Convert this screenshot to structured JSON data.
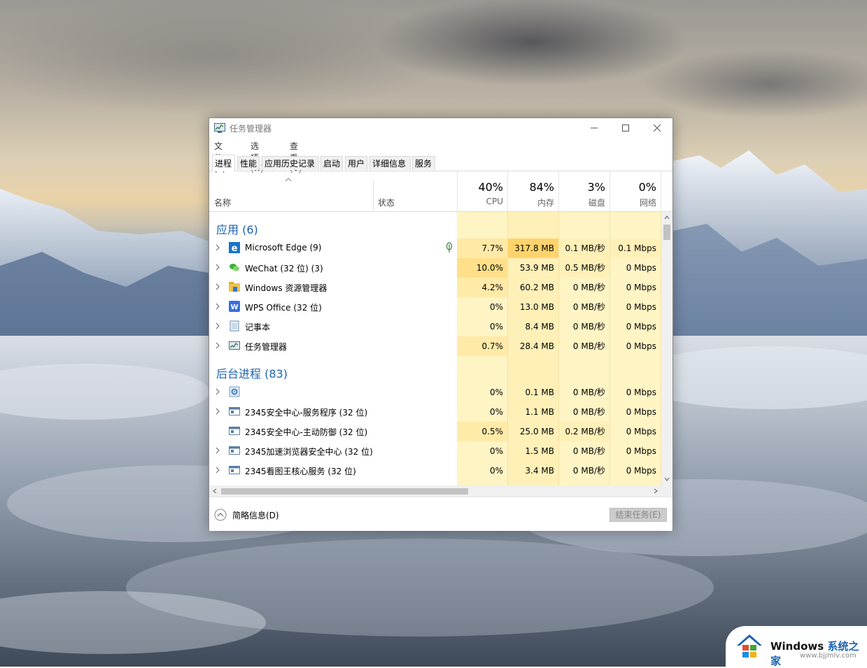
{
  "window": {
    "title": "任务管理器",
    "menu": [
      "文件(F)",
      "选项(O)",
      "查看(V)"
    ],
    "tabs": [
      "进程",
      "性能",
      "应用历史记录",
      "启动",
      "用户",
      "详细信息",
      "服务"
    ]
  },
  "columns": {
    "name": "名称",
    "status": "状态",
    "cpu": {
      "pct": "40%",
      "label": "CPU"
    },
    "memory": {
      "pct": "84%",
      "label": "内存"
    },
    "disk": {
      "pct": "3%",
      "label": "磁盘"
    },
    "network": {
      "pct": "0%",
      "label": "网络"
    }
  },
  "groups": {
    "apps": "应用 (6)",
    "background": "后台进程 (83)"
  },
  "apps": [
    {
      "name": "Microsoft Edge (9)",
      "cpu": "7.7%",
      "mem": "317.8 MB",
      "disk": "0.1 MB/秒",
      "net": "0.1 Mbps",
      "icon": "edge-icon"
    },
    {
      "name": "WeChat (32 位) (3)",
      "cpu": "10.0%",
      "mem": "53.9 MB",
      "disk": "0.5 MB/秒",
      "net": "0 Mbps",
      "icon": "wechat-icon"
    },
    {
      "name": "Windows 资源管理器",
      "cpu": "4.2%",
      "mem": "60.2 MB",
      "disk": "0 MB/秒",
      "net": "0 Mbps",
      "icon": "explorer-icon"
    },
    {
      "name": "WPS Office (32 位)",
      "cpu": "0%",
      "mem": "13.0 MB",
      "disk": "0 MB/秒",
      "net": "0 Mbps",
      "icon": "wps-icon"
    },
    {
      "name": "记事本",
      "cpu": "0%",
      "mem": "8.4 MB",
      "disk": "0 MB/秒",
      "net": "0 Mbps",
      "icon": "notepad-icon"
    },
    {
      "name": "任务管理器",
      "cpu": "0.7%",
      "mem": "28.4 MB",
      "disk": "0 MB/秒",
      "net": "0 Mbps",
      "icon": "taskmgr-icon"
    }
  ],
  "background": [
    {
      "name": "",
      "cpu": "0%",
      "mem": "0.1 MB",
      "disk": "0 MB/秒",
      "net": "0 Mbps",
      "icon": "gear-icon"
    },
    {
      "name": "2345安全中心-服务程序 (32 位)",
      "cpu": "0%",
      "mem": "1.1 MB",
      "disk": "0 MB/秒",
      "net": "0 Mbps",
      "icon": "service-window-icon"
    },
    {
      "name": "2345安全中心-主动防御 (32 位)",
      "cpu": "0.5%",
      "mem": "25.0 MB",
      "disk": "0.2 MB/秒",
      "net": "0 Mbps",
      "icon": "service-window-icon"
    },
    {
      "name": "2345加速浏览器安全中心 (32 位)",
      "cpu": "0%",
      "mem": "1.5 MB",
      "disk": "0 MB/秒",
      "net": "0 Mbps",
      "icon": "service-window-icon"
    },
    {
      "name": "2345看图王核心服务 (32 位)",
      "cpu": "0%",
      "mem": "3.4 MB",
      "disk": "0 MB/秒",
      "net": "0 Mbps",
      "icon": "service-window-icon"
    }
  ],
  "footer": {
    "fewer_details": "简略信息(D)",
    "end_task": "结束任务(E)"
  },
  "watermark": {
    "brand_a": "Windows",
    "brand_b": "系统之家",
    "url": "www.bjjmlv.com"
  }
}
